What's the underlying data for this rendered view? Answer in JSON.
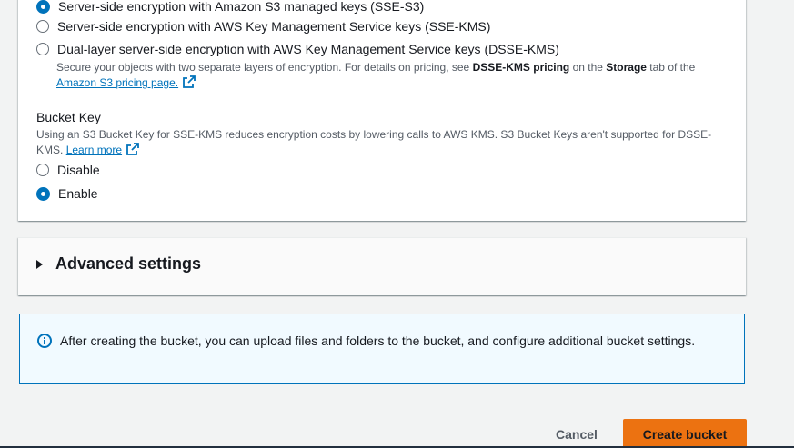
{
  "encryption": {
    "options": [
      {
        "label": "Server-side encryption with Amazon S3 managed keys (SSE-S3)",
        "checked": true
      },
      {
        "label": "Server-side encryption with AWS Key Management Service keys (SSE-KMS)",
        "checked": false
      },
      {
        "label": "Dual-layer server-side encryption with AWS Key Management Service keys (DSSE-KMS)",
        "checked": false
      }
    ],
    "dsse_desc": {
      "part1": "Secure your objects with two separate layers of encryption. For details on pricing, see ",
      "bold1": "DSSE-KMS pricing",
      "part2": " on the ",
      "bold2": "Storage",
      "part3": " tab of the",
      "link": "Amazon S3 pricing page."
    }
  },
  "bucket_key": {
    "label": "Bucket Key",
    "desc": "Using an S3 Bucket Key for SSE-KMS reduces encryption costs by lowering calls to AWS KMS. S3 Bucket Keys aren't supported for DSSE-KMS.",
    "learn_more": "Learn more",
    "options": [
      {
        "label": "Disable",
        "checked": false
      },
      {
        "label": "Enable",
        "checked": true
      }
    ]
  },
  "advanced": {
    "title": "Advanced settings"
  },
  "info": {
    "text": "After creating the bucket, you can upload files and folders to the bucket, and configure additional bucket settings."
  },
  "footer": {
    "cancel_label": "Cancel",
    "create_label": "Create bucket"
  },
  "colors": {
    "accent": "#0073bb",
    "primary_button": "#ec7211",
    "info_bg": "#f1faff"
  }
}
